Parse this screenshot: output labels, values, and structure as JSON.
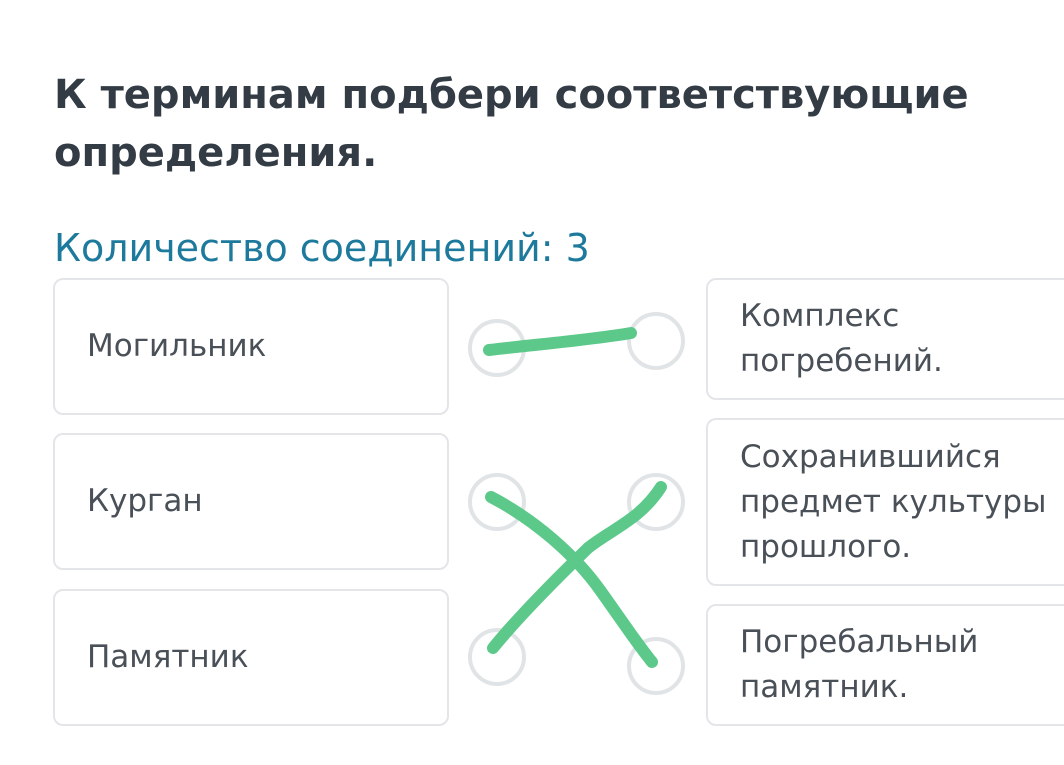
{
  "task": {
    "title": "К терминам подбери соответствующие определения.",
    "counter": "Количество соединений: 3"
  },
  "terms": [
    {
      "label": "Могильник"
    },
    {
      "label": "Курган"
    },
    {
      "label": "Памятник"
    }
  ],
  "definitions": [
    {
      "lines": [
        "Комплекс",
        "погребений."
      ]
    },
    {
      "lines": [
        "Сохранившийся",
        "предмет культуры",
        "прошлого."
      ]
    },
    {
      "lines": [
        "Погребальный",
        "памятник."
      ]
    }
  ],
  "colors": {
    "title": "#333b45",
    "counter": "#1d7a9c",
    "card_border": "#e3e5e8",
    "dot_border": "#e1e4e6",
    "drawn_line": "#5cc98a"
  }
}
